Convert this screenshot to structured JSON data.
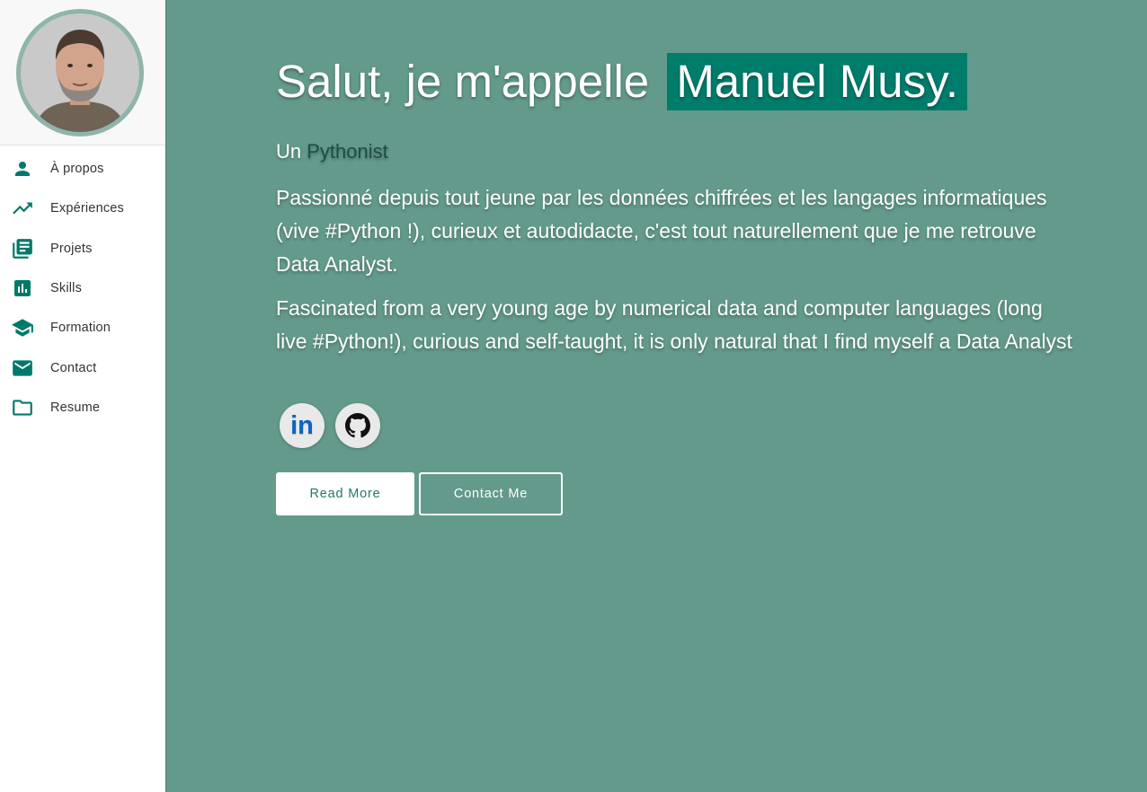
{
  "sidebar": {
    "items": [
      {
        "label": "À propos",
        "icon": "person-icon"
      },
      {
        "label": "Expériences",
        "icon": "trending-up-icon"
      },
      {
        "label": "Projets",
        "icon": "library-books-icon"
      },
      {
        "label": "Skills",
        "icon": "bar-chart-icon"
      },
      {
        "label": "Formation",
        "icon": "school-icon"
      },
      {
        "label": "Contact",
        "icon": "mail-icon"
      },
      {
        "label": "Resume",
        "icon": "folder-icon"
      }
    ]
  },
  "hero": {
    "greeting": "Salut, je m'appelle",
    "name": "Manuel Musy.",
    "tagline_prefix": "Un",
    "tagline_highlight": "Pythonist",
    "paragraph_fr": "Passionné depuis tout jeune par les données chiffrées et les langages informatiques (vive #Python !), curieux et autodidacte, c'est tout naturellement que je me retrouve Data Analyst.",
    "paragraph_en": "Fascinated from a very young age by numerical data and computer languages (long live #Python!), curious and self-taught, it is only natural that I find myself a Data Analyst",
    "social": [
      {
        "name": "linkedin-icon",
        "text": "in"
      },
      {
        "name": "github-icon"
      }
    ],
    "read_more": "Read More",
    "contact_me": "Contact Me"
  },
  "colors": {
    "accent": "#00796b",
    "background": "#639a8b",
    "name_highlight_bg": "#007c6b",
    "tagline_highlight": "#1d4e43",
    "linkedin_blue": "#0a66c2"
  }
}
